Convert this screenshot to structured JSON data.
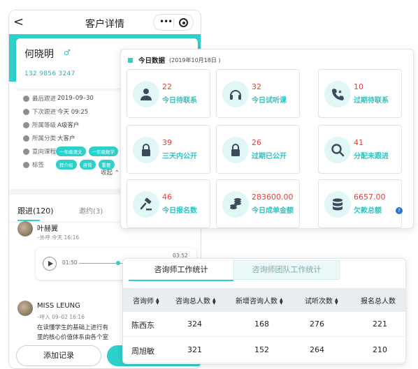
{
  "phone": {
    "nav": {
      "back": "<",
      "title": "客户详情",
      "menu_dots": "•••"
    },
    "customer": {
      "name": "何晓明",
      "gender_symbol": "♂",
      "phone": "132 9856 3247"
    },
    "info": [
      {
        "label": "最后跟进",
        "value": "2019–09–30"
      },
      {
        "label": "下次跟进",
        "value": "今天 09:25"
      },
      {
        "label": "所属等级",
        "value": "A级客户"
      },
      {
        "label": "所属分类",
        "value": "大客户"
      },
      {
        "label": "意向课程",
        "tags": [
          "一年级语文",
          "一年级数学"
        ]
      },
      {
        "label": "标签",
        "tags": [
          "转介绍",
          "咨询",
          "重要"
        ]
      }
    ],
    "collapse": "收起 ⌃",
    "tabs": {
      "follow": "跟进(120)",
      "invite": "邀约(3)"
    },
    "records": [
      {
        "name": "叶赫翼",
        "meta": "–外呼   今天 16:16",
        "text": ""
      },
      {
        "name": "MISS LEUNG",
        "meta": "–呼入   09–02 16:16",
        "text": "在读懂学生的基础上进行有",
        "text2": "里的核心价值体系由各个室"
      }
    ],
    "audio": {
      "current": "01:50",
      "duration": "03:52",
      "progress": 0.4
    },
    "buttons": {
      "add_record": "添加记录"
    }
  },
  "today": {
    "title": "今日数据",
    "date": "(2019年10月18日 )",
    "cards": [
      {
        "value": "22",
        "label": "今日待联系",
        "icon": "user-icon"
      },
      {
        "value": "32",
        "label": "今日试听课",
        "icon": "headphones-icon"
      },
      {
        "value": "10",
        "label": "过期待联系",
        "icon": "phone-missed-icon"
      },
      {
        "value": "39",
        "label": "三天内公开",
        "icon": "lock-icon"
      },
      {
        "value": "26",
        "label": "过期已公开",
        "icon": "lock-icon"
      },
      {
        "value": "41",
        "label": "分配未跟进",
        "icon": "search-icon"
      },
      {
        "value": "46",
        "label": "今日报名数",
        "icon": "gavel-icon"
      },
      {
        "value": "283600.00",
        "label": "今日成单金额",
        "icon": "coins-icon"
      },
      {
        "value": "6657.00",
        "label": "欠款总额",
        "icon": "database-icon",
        "help": "?"
      }
    ]
  },
  "stats": {
    "tabs": [
      "咨询师工作统计",
      "咨询师团队工作统计"
    ],
    "columns": [
      "咨询师",
      "咨询总人数",
      "新增咨询人数",
      "试听次数",
      "报名总人数"
    ],
    "rows": [
      [
        "陈西东",
        "324",
        "168",
        "276",
        "221"
      ],
      [
        "周旭敏",
        "321",
        "152",
        "264",
        "210"
      ]
    ]
  },
  "colors": {
    "accent": "#2ed0cb",
    "number_red": "#e2403a",
    "label_teal": "#2ec4c0"
  }
}
